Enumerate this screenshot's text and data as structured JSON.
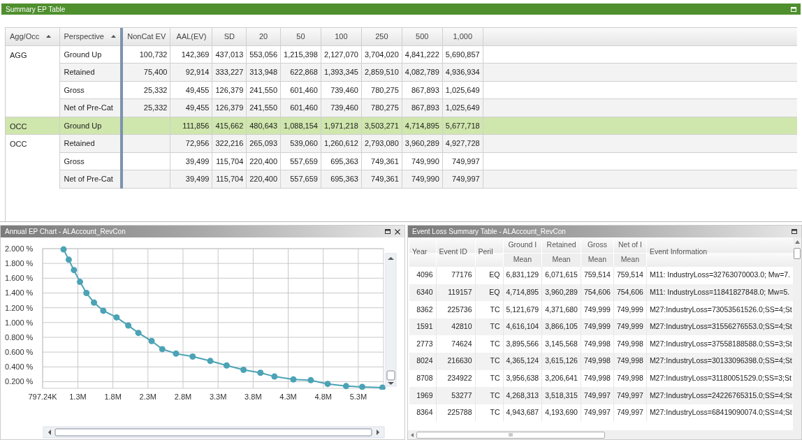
{
  "summary_panel": {
    "title": "Summary EP Table",
    "columns": [
      {
        "label": "Agg/Occ",
        "sorted": true
      },
      {
        "label": "Perspective",
        "sorted": true
      },
      {
        "label": "NonCat EV",
        "sorted": false
      },
      {
        "label": "AAL(EV)",
        "sorted": false
      },
      {
        "label": "SD",
        "sorted": false
      },
      {
        "label": "20",
        "sorted": false
      },
      {
        "label": "50",
        "sorted": false
      },
      {
        "label": "100",
        "sorted": false
      },
      {
        "label": "250",
        "sorted": false
      },
      {
        "label": "500",
        "sorted": false
      },
      {
        "label": "1,000",
        "sorted": false
      }
    ],
    "rows": [
      {
        "agg_occ": "AGG",
        "perspective": "Ground Up",
        "selected": false,
        "noncat_ev": "100,732",
        "values": [
          "142,369",
          "437,013",
          "553,056",
          "1,215,398",
          "2,127,070",
          "3,704,020",
          "4,841,222",
          "5,690,857"
        ]
      },
      {
        "perspective": "Retained",
        "selected": false,
        "noncat_ev": "75,400",
        "values": [
          "92,914",
          "333,227",
          "313,948",
          "622,868",
          "1,393,345",
          "2,859,510",
          "4,082,789",
          "4,936,934"
        ]
      },
      {
        "perspective": "Gross",
        "selected": false,
        "noncat_ev": "25,332",
        "values": [
          "49,455",
          "126,379",
          "241,550",
          "601,460",
          "739,460",
          "780,275",
          "867,893",
          "1,025,649"
        ]
      },
      {
        "perspective": "Net of Pre-Cat",
        "selected": false,
        "noncat_ev": "25,332",
        "values": [
          "49,455",
          "126,379",
          "241,550",
          "601,460",
          "739,460",
          "780,275",
          "867,893",
          "1,025,649"
        ]
      },
      {
        "agg_occ": "OCC",
        "perspective": "Ground Up",
        "selected": true,
        "values": [
          "111,856",
          "415,662",
          "480,643",
          "1,088,154",
          "1,971,218",
          "3,503,271",
          "4,714,895",
          "5,677,718"
        ]
      },
      {
        "agg_occ": "OCC",
        "perspective": "Retained",
        "selected": false,
        "values": [
          "72,956",
          "322,216",
          "265,093",
          "539,060",
          "1,260,612",
          "2,793,080",
          "3,960,289",
          "4,927,728"
        ]
      },
      {
        "perspective": "Gross",
        "selected": false,
        "values": [
          "39,499",
          "115,704",
          "220,400",
          "557,659",
          "695,363",
          "749,361",
          "749,990",
          "749,997"
        ]
      },
      {
        "perspective": "Net of Pre-Cat",
        "selected": false,
        "values": [
          "39,499",
          "115,704",
          "220,400",
          "557,659",
          "695,363",
          "749,361",
          "749,990",
          "749,997"
        ]
      }
    ]
  },
  "chart_panel": {
    "title": "Annual EP Chart - ALAccount_RevCon",
    "chart_data": {
      "type": "line",
      "grid": true,
      "x": [
        1096000,
        1170000,
        1244000,
        1330000,
        1422000,
        1530000,
        1663000,
        1852000,
        2019000,
        2163000,
        2352000,
        2504000,
        2700000,
        2937000,
        3189000,
        3422000,
        3663000,
        3904000,
        4104000,
        4374000,
        4622000,
        4863000,
        5126000,
        5356000,
        5644000
      ],
      "series": [
        {
          "color": "#4ba3b5",
          "marker": "circle",
          "values": [
            1.99,
            1.85,
            1.71,
            1.55,
            1.4,
            1.27,
            1.16,
            1.07,
            0.96,
            0.86,
            0.75,
            0.64,
            0.58,
            0.54,
            0.48,
            0.42,
            0.36,
            0.32,
            0.27,
            0.23,
            0.22,
            0.17,
            0.14,
            0.13,
            0.12
          ]
        }
      ],
      "xlim": [
        797240,
        5660000
      ],
      "ylim": [
        0.11,
        2.0
      ],
      "xticks": [
        {
          "value": 797240,
          "label": "797.24K"
        },
        {
          "value": 1300000,
          "label": "1.3M"
        },
        {
          "value": 1800000,
          "label": "1.8M"
        },
        {
          "value": 2300000,
          "label": "2.3M"
        },
        {
          "value": 2800000,
          "label": "2.8M"
        },
        {
          "value": 3300000,
          "label": "3.3M"
        },
        {
          "value": 3800000,
          "label": "3.8M"
        },
        {
          "value": 4300000,
          "label": "4.3M"
        },
        {
          "value": 4800000,
          "label": "4.8M"
        },
        {
          "value": 5300000,
          "label": "5.3M"
        }
      ],
      "yticks": [
        {
          "value": 0.2,
          "label": "0.200 %"
        },
        {
          "value": 0.4,
          "label": "0.400 %"
        },
        {
          "value": 0.6,
          "label": "0.600 %"
        },
        {
          "value": 0.8,
          "label": "0.800 %"
        },
        {
          "value": 1.0,
          "label": "1.000 %"
        },
        {
          "value": 1.2,
          "label": "1.200 %"
        },
        {
          "value": 1.4,
          "label": "1.400 %"
        },
        {
          "value": 1.6,
          "label": "1.600 %"
        },
        {
          "value": 1.8,
          "label": "1.800 %"
        },
        {
          "value": 2.0,
          "label": "2.000 %"
        }
      ]
    }
  },
  "event_panel": {
    "title": "Event Loss Summary Table - ALAccount_RevCon",
    "columns": [
      {
        "label": "Year"
      },
      {
        "label": "Event ID"
      },
      {
        "label": "Peril"
      },
      {
        "label": "Ground I",
        "sub": "Mean"
      },
      {
        "label": "Retained",
        "sub": "Mean"
      },
      {
        "label": "Gross",
        "sub": "Mean"
      },
      {
        "label": "Net of I",
        "sub": "Mean"
      },
      {
        "label": "Event Information"
      }
    ],
    "rows": [
      [
        "4096",
        "77176",
        "EQ",
        "6,831,129",
        "6,071,615",
        "759,514",
        "759,514",
        "M11: IndustryLoss=32763070003.0; Mw=7."
      ],
      [
        "6340",
        "119157",
        "EQ",
        "4,714,895",
        "3,960,289",
        "754,606",
        "754,606",
        "M11: IndustryLoss=11841827848.0; Mw=5."
      ],
      [
        "8362",
        "225736",
        "TC",
        "5,121,679",
        "4,371,680",
        "749,999",
        "749,999",
        "M27:IndustryLoss=73053561526.0;SS=4;St"
      ],
      [
        "1591",
        "42810",
        "TC",
        "4,616,104",
        "3,866,105",
        "749,999",
        "749,999",
        "M27:IndustryLoss=31556276553.0;SS=4;St"
      ],
      [
        "2773",
        "74624",
        "TC",
        "3,895,566",
        "3,145,568",
        "749,998",
        "749,998",
        "M27:IndustryLoss=37558188588.0;SS=3;St"
      ],
      [
        "8024",
        "216630",
        "TC",
        "4,365,124",
        "3,615,126",
        "749,998",
        "749,998",
        "M27:IndustryLoss=30133096398.0;SS=4;St"
      ],
      [
        "8708",
        "234922",
        "TC",
        "3,956,638",
        "3,206,641",
        "749,998",
        "749,998",
        "M27:IndustryLoss=31180051529.0;SS=3;St"
      ],
      [
        "1969",
        "53277",
        "TC",
        "4,268,313",
        "3,518,315",
        "749,997",
        "749,997",
        "M27:IndustryLoss=24226765315.0;SS=4;St"
      ],
      [
        "8364",
        "225788",
        "TC",
        "4,943,687",
        "4,193,690",
        "749,997",
        "749,997",
        "M27:IndustryLoss=68419090074.0;SS=4;St"
      ]
    ],
    "scroll_label": "III"
  }
}
